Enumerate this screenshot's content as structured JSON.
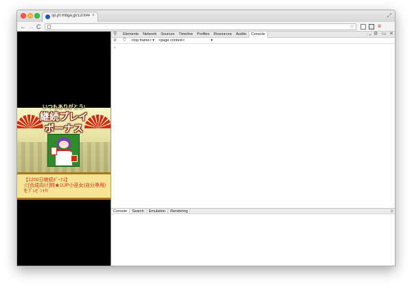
{
  "tab": {
    "title": "sp.pf.mbga.jp/12004445",
    "close_glyph": "×",
    "favicon": "favicon-icon"
  },
  "window_controls": {
    "fullscreen_glyph": "⤢"
  },
  "nav": {
    "back_glyph": "←",
    "forward_glyph": "→",
    "reload_glyph": "C"
  },
  "omnibox": {
    "value": "",
    "placeholder": "",
    "star_glyph": "☆"
  },
  "toolbar": {
    "menu_glyph": "≡",
    "icons": [
      "mail-extension-icon",
      "badge-extension-icon",
      "menu-icon"
    ]
  },
  "page": {
    "banner": {
      "line1": "いつもありがとう!",
      "title_line1": "継続プレイ",
      "title_line2": "ボーナス"
    },
    "scroll": {
      "text1": "【1200日継続ﾎﾞｰﾅｽ】",
      "text2": "☆[合成向け]特★1UP小巫女(自分専用)",
      "text3": "をﾌﾟﾚｾﾞﾝﾄ!!"
    },
    "colors": {
      "background": "#000000",
      "accent_red": "#d12a17",
      "scroll_bg": "#f7e596"
    }
  },
  "devtools": {
    "search_glyph": "⚲",
    "tabs": [
      {
        "label": "Elements",
        "active": false
      },
      {
        "label": "Network",
        "active": false
      },
      {
        "label": "Sources",
        "active": false
      },
      {
        "label": "Timeline",
        "active": false
      },
      {
        "label": "Profiles",
        "active": false
      },
      {
        "label": "Resources",
        "active": false
      },
      {
        "label": "Audits",
        "active": false
      },
      {
        "label": "Console",
        "active": true
      }
    ],
    "right_icons": {
      "errors": "⋮≡",
      "settings": "⚙",
      "dock": "▭",
      "close": "✕"
    },
    "console_toolbar": {
      "clear_glyph": "⊘",
      "filter_glyph": "⛉",
      "frame": "<top frame> ▾",
      "context": "<page context>",
      "context_arrow": "▾"
    },
    "prompt_glyph": "›",
    "drawer": {
      "tabs": [
        {
          "label": "Console",
          "active": true
        },
        {
          "label": "Search",
          "active": false
        },
        {
          "label": "Emulation",
          "active": false
        },
        {
          "label": "Rendering",
          "active": false
        }
      ],
      "close_glyph": "⊠"
    }
  }
}
